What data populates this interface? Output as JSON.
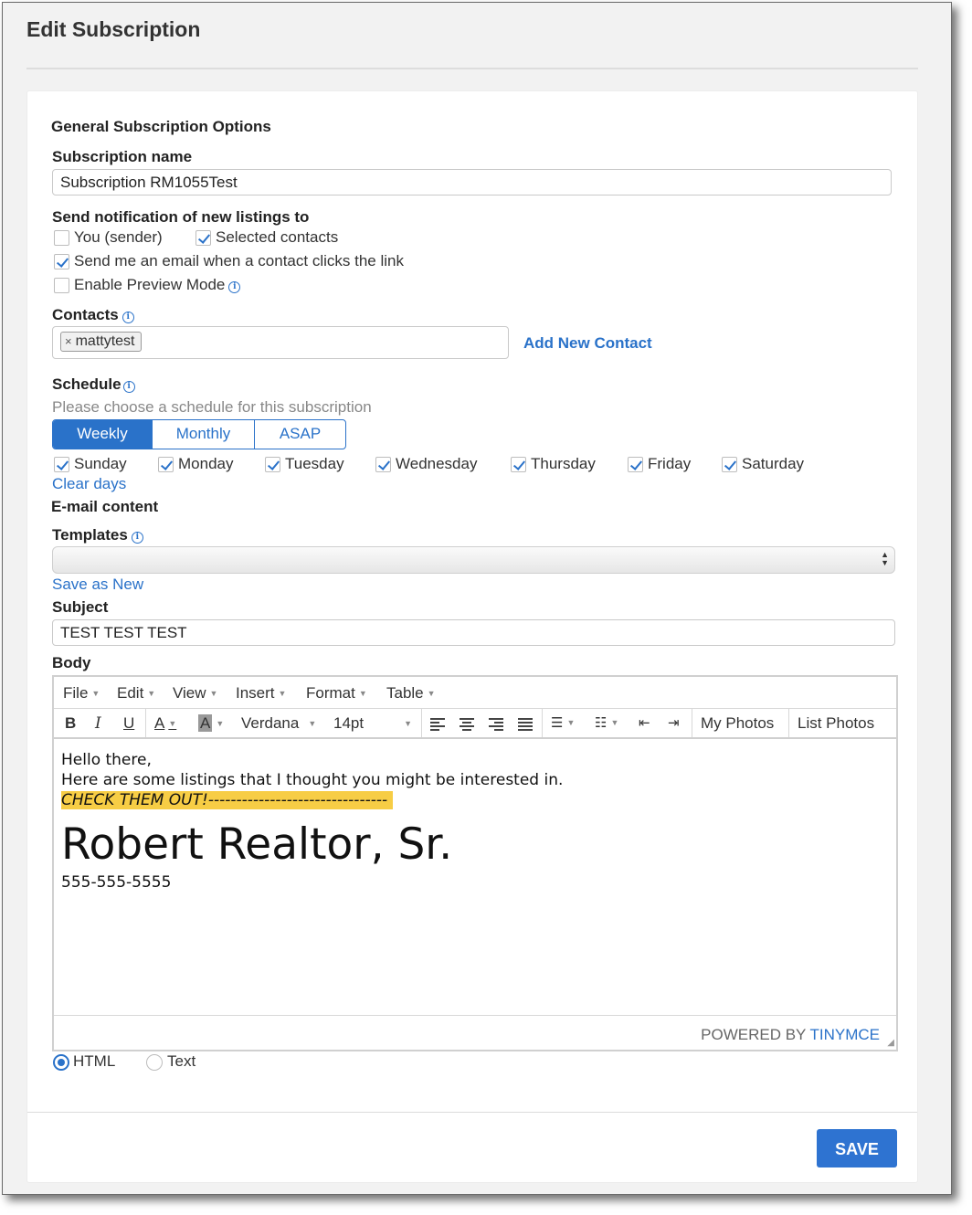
{
  "page": {
    "title": "Edit Subscription"
  },
  "general": {
    "heading": "General Subscription Options",
    "name_label": "Subscription name",
    "name_value": "Subscription RM1055Test"
  },
  "notify": {
    "label": "Send notification of new listings to",
    "you_sender": {
      "label": "You (sender)",
      "checked": false
    },
    "selected_contacts": {
      "label": "Selected contacts",
      "checked": true
    },
    "email_on_click": {
      "label": "Send me an email when a contact clicks the link",
      "checked": true
    },
    "preview_mode": {
      "label": "Enable Preview Mode",
      "checked": false
    }
  },
  "contacts": {
    "label": "Contacts",
    "tags": [
      "mattytest"
    ],
    "tag_remove": "×",
    "add_link": "Add New Contact"
  },
  "schedule": {
    "label": "Schedule",
    "hint": "Please choose a schedule for this subscription",
    "tabs": [
      "Weekly",
      "Monthly",
      "ASAP"
    ],
    "active_tab": "Weekly",
    "days": [
      "Sunday",
      "Monday",
      "Tuesday",
      "Wednesday",
      "Thursday",
      "Friday",
      "Saturday"
    ],
    "clear_link": "Clear days"
  },
  "email": {
    "heading": "E-mail content",
    "templates_label": "Templates",
    "templates_value": "",
    "save_as_new": "Save as New",
    "subject_label": "Subject",
    "subject_value": "TEST TEST TEST",
    "body_label": "Body"
  },
  "editor": {
    "menu": [
      "File",
      "Edit",
      "View",
      "Insert",
      "Format",
      "Table"
    ],
    "font_family": "Verdana",
    "font_size": "14pt",
    "my_photos": "My Photos",
    "list_photos": "List Photos",
    "content": {
      "line1": "Hello there,",
      "line2": "Here are some listings that I thought you might be interested in.",
      "highlight": "CHECK THEM OUT!--------------------------------",
      "name": "Robert Realtor, Sr.",
      "phone": "555-555-5555"
    },
    "powered_by": "POWERED BY",
    "brand": "TINYMCE"
  },
  "format": {
    "html_label": "HTML",
    "text_label": "Text",
    "selected": "HTML"
  },
  "actions": {
    "save_label": "SAVE"
  },
  "colors": {
    "accent": "#2a72c9",
    "highlight": "#f7cd45"
  }
}
